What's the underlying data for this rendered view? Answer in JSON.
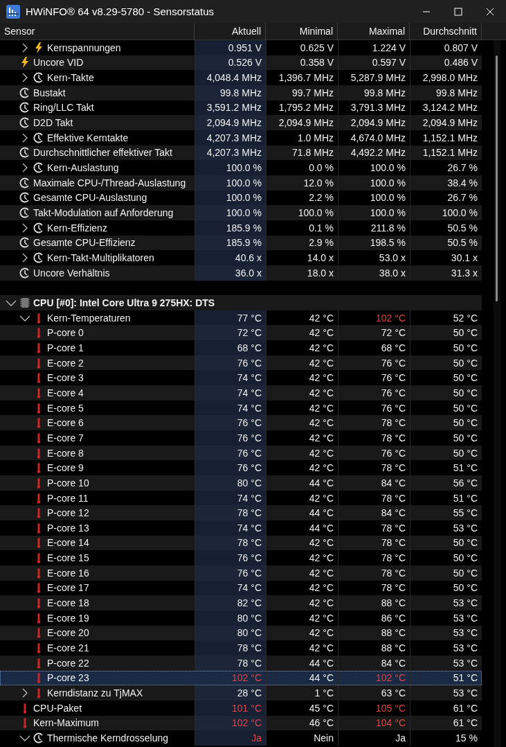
{
  "window": {
    "title": "HWiNFO® 64 v8.29-5780 - Sensorstatus"
  },
  "columns": [
    "Sensor",
    "Aktuell",
    "Minimal",
    "Maximal",
    "Durchschnitt"
  ],
  "groups": [
    {
      "rows": [
        {
          "label": "Kernspannungen",
          "kind": "bolt",
          "expanded": false,
          "selected": false,
          "values": [
            {
              "text": "0.951 V",
              "alert": false
            },
            {
              "text": "0.625 V",
              "alert": false
            },
            {
              "text": "1.224 V",
              "alert": false
            },
            {
              "text": "0.807 V",
              "alert": false
            }
          ]
        },
        {
          "label": "Uncore VID",
          "kind": "bolt",
          "selected": false,
          "values": [
            {
              "text": "0.526 V",
              "alert": false
            },
            {
              "text": "0.358 V",
              "alert": false
            },
            {
              "text": "0.597 V",
              "alert": false
            },
            {
              "text": "0.486 V",
              "alert": false
            }
          ]
        },
        {
          "label": "Kern-Takte",
          "kind": "clock",
          "expanded": false,
          "selected": false,
          "values": [
            {
              "text": "4,048.4 MHz",
              "alert": false
            },
            {
              "text": "1,396.7 MHz",
              "alert": false
            },
            {
              "text": "5,287.9 MHz",
              "alert": false
            },
            {
              "text": "2,998.0 MHz",
              "alert": false
            }
          ]
        },
        {
          "label": "Bustakt",
          "kind": "clock",
          "selected": false,
          "values": [
            {
              "text": "99.8 MHz",
              "alert": false
            },
            {
              "text": "99.7 MHz",
              "alert": false
            },
            {
              "text": "99.8 MHz",
              "alert": false
            },
            {
              "text": "99.8 MHz",
              "alert": false
            }
          ]
        },
        {
          "label": "Ring/LLC Takt",
          "kind": "clock",
          "selected": false,
          "values": [
            {
              "text": "3,591.2 MHz",
              "alert": false
            },
            {
              "text": "1,795.2 MHz",
              "alert": false
            },
            {
              "text": "3,791.3 MHz",
              "alert": false
            },
            {
              "text": "3,124.2 MHz",
              "alert": false
            }
          ]
        },
        {
          "label": "D2D Takt",
          "kind": "clock",
          "selected": false,
          "values": [
            {
              "text": "2,094.9 MHz",
              "alert": false
            },
            {
              "text": "2,094.9 MHz",
              "alert": false
            },
            {
              "text": "2,094.9 MHz",
              "alert": false
            },
            {
              "text": "2,094.9 MHz",
              "alert": false
            }
          ]
        },
        {
          "label": "Effektive Kerntakte",
          "kind": "clock",
          "expanded": false,
          "selected": false,
          "values": [
            {
              "text": "4,207.3 MHz",
              "alert": false
            },
            {
              "text": "1.0 MHz",
              "alert": false
            },
            {
              "text": "4,674.0 MHz",
              "alert": false
            },
            {
              "text": "1,152.1 MHz",
              "alert": false
            }
          ]
        },
        {
          "label": "Durchschnittlicher effektiver Takt",
          "kind": "clock",
          "selected": false,
          "values": [
            {
              "text": "4,207.3 MHz",
              "alert": false
            },
            {
              "text": "71.8 MHz",
              "alert": false
            },
            {
              "text": "4,492.2 MHz",
              "alert": false
            },
            {
              "text": "1,152.1 MHz",
              "alert": false
            }
          ]
        },
        {
          "label": "Kern-Auslastung",
          "kind": "clock",
          "expanded": false,
          "selected": false,
          "values": [
            {
              "text": "100.0 %",
              "alert": false
            },
            {
              "text": "0.0 %",
              "alert": false
            },
            {
              "text": "100.0 %",
              "alert": false
            },
            {
              "text": "26.7 %",
              "alert": false
            }
          ]
        },
        {
          "label": "Maximale CPU-/Thread-Auslastung",
          "kind": "clock",
          "selected": false,
          "values": [
            {
              "text": "100.0 %",
              "alert": false
            },
            {
              "text": "12.0 %",
              "alert": false
            },
            {
              "text": "100.0 %",
              "alert": false
            },
            {
              "text": "38.4 %",
              "alert": false
            }
          ]
        },
        {
          "label": "Gesamte CPU-Auslastung",
          "kind": "clock",
          "selected": false,
          "values": [
            {
              "text": "100.0 %",
              "alert": false
            },
            {
              "text": "2.2 %",
              "alert": false
            },
            {
              "text": "100.0 %",
              "alert": false
            },
            {
              "text": "26.7 %",
              "alert": false
            }
          ]
        },
        {
          "label": "Takt-Modulation auf Anforderung",
          "kind": "clock",
          "selected": false,
          "values": [
            {
              "text": "100.0 %",
              "alert": false
            },
            {
              "text": "100.0 %",
              "alert": false
            },
            {
              "text": "100.0 %",
              "alert": false
            },
            {
              "text": "100.0 %",
              "alert": false
            }
          ]
        },
        {
          "label": "Kern-Effizienz",
          "kind": "clock",
          "expanded": false,
          "selected": false,
          "values": [
            {
              "text": "185.9 %",
              "alert": false
            },
            {
              "text": "0.1 %",
              "alert": false
            },
            {
              "text": "211.8 %",
              "alert": false
            },
            {
              "text": "50.5 %",
              "alert": false
            }
          ]
        },
        {
          "label": "Gesamte CPU-Effizienz",
          "kind": "clock",
          "selected": false,
          "values": [
            {
              "text": "185.9 %",
              "alert": false
            },
            {
              "text": "2.9 %",
              "alert": false
            },
            {
              "text": "198.5 %",
              "alert": false
            },
            {
              "text": "50.5 %",
              "alert": false
            }
          ]
        },
        {
          "label": "Kern-Takt-Multiplikatoren",
          "kind": "clock",
          "expanded": false,
          "selected": false,
          "values": [
            {
              "text": "40.6 x",
              "alert": false
            },
            {
              "text": "14.0 x",
              "alert": false
            },
            {
              "text": "53.0 x",
              "alert": false
            },
            {
              "text": "30.1 x",
              "alert": false
            }
          ]
        },
        {
          "label": "Uncore Verhältnis",
          "kind": "clock",
          "selected": false,
          "values": [
            {
              "text": "36.0 x",
              "alert": false
            },
            {
              "text": "18.0 x",
              "alert": false
            },
            {
              "text": "38.0 x",
              "alert": false
            },
            {
              "text": "31.3 x",
              "alert": false
            }
          ]
        }
      ]
    },
    {
      "title": "CPU [#0]: Intel Core Ultra 9 275HX: DTS",
      "expanded": true,
      "rows": [
        {
          "label": "Kern-Temperaturen",
          "kind": "thermometer",
          "expanded": true,
          "selected": false,
          "values": [
            {
              "text": "77 °C",
              "alert": false
            },
            {
              "text": "42 °C",
              "alert": false
            },
            {
              "text": "102 °C",
              "alert": true
            },
            {
              "text": "52 °C",
              "alert": false
            }
          ],
          "children": [
            {
              "label": "P-core 0",
              "kind": "thermometer",
              "selected": false,
              "values": [
                {
                  "text": "72 °C",
                  "alert": false
                },
                {
                  "text": "42 °C",
                  "alert": false
                },
                {
                  "text": "72 °C",
                  "alert": false
                },
                {
                  "text": "50 °C",
                  "alert": false
                }
              ]
            },
            {
              "label": "P-core 1",
              "kind": "thermometer",
              "selected": false,
              "values": [
                {
                  "text": "68 °C",
                  "alert": false
                },
                {
                  "text": "42 °C",
                  "alert": false
                },
                {
                  "text": "68 °C",
                  "alert": false
                },
                {
                  "text": "50 °C",
                  "alert": false
                }
              ]
            },
            {
              "label": "E-core 2",
              "kind": "thermometer",
              "selected": false,
              "values": [
                {
                  "text": "76 °C",
                  "alert": false
                },
                {
                  "text": "42 °C",
                  "alert": false
                },
                {
                  "text": "76 °C",
                  "alert": false
                },
                {
                  "text": "50 °C",
                  "alert": false
                }
              ]
            },
            {
              "label": "E-core 3",
              "kind": "thermometer",
              "selected": false,
              "values": [
                {
                  "text": "74 °C",
                  "alert": false
                },
                {
                  "text": "42 °C",
                  "alert": false
                },
                {
                  "text": "76 °C",
                  "alert": false
                },
                {
                  "text": "50 °C",
                  "alert": false
                }
              ]
            },
            {
              "label": "E-core 4",
              "kind": "thermometer",
              "selected": false,
              "values": [
                {
                  "text": "74 °C",
                  "alert": false
                },
                {
                  "text": "42 °C",
                  "alert": false
                },
                {
                  "text": "76 °C",
                  "alert": false
                },
                {
                  "text": "50 °C",
                  "alert": false
                }
              ]
            },
            {
              "label": "E-core 5",
              "kind": "thermometer",
              "selected": false,
              "values": [
                {
                  "text": "74 °C",
                  "alert": false
                },
                {
                  "text": "42 °C",
                  "alert": false
                },
                {
                  "text": "76 °C",
                  "alert": false
                },
                {
                  "text": "50 °C",
                  "alert": false
                }
              ]
            },
            {
              "label": "E-core 6",
              "kind": "thermometer",
              "selected": false,
              "values": [
                {
                  "text": "76 °C",
                  "alert": false
                },
                {
                  "text": "42 °C",
                  "alert": false
                },
                {
                  "text": "78 °C",
                  "alert": false
                },
                {
                  "text": "50 °C",
                  "alert": false
                }
              ]
            },
            {
              "label": "E-core 7",
              "kind": "thermometer",
              "selected": false,
              "values": [
                {
                  "text": "76 °C",
                  "alert": false
                },
                {
                  "text": "42 °C",
                  "alert": false
                },
                {
                  "text": "78 °C",
                  "alert": false
                },
                {
                  "text": "50 °C",
                  "alert": false
                }
              ]
            },
            {
              "label": "E-core 8",
              "kind": "thermometer",
              "selected": false,
              "values": [
                {
                  "text": "76 °C",
                  "alert": false
                },
                {
                  "text": "42 °C",
                  "alert": false
                },
                {
                  "text": "76 °C",
                  "alert": false
                },
                {
                  "text": "50 °C",
                  "alert": false
                }
              ]
            },
            {
              "label": "E-core 9",
              "kind": "thermometer",
              "selected": false,
              "values": [
                {
                  "text": "76 °C",
                  "alert": false
                },
                {
                  "text": "42 °C",
                  "alert": false
                },
                {
                  "text": "78 °C",
                  "alert": false
                },
                {
                  "text": "51 °C",
                  "alert": false
                }
              ]
            },
            {
              "label": "P-core 10",
              "kind": "thermometer",
              "selected": false,
              "values": [
                {
                  "text": "80 °C",
                  "alert": false
                },
                {
                  "text": "44 °C",
                  "alert": false
                },
                {
                  "text": "84 °C",
                  "alert": false
                },
                {
                  "text": "56 °C",
                  "alert": false
                }
              ]
            },
            {
              "label": "P-core 11",
              "kind": "thermometer",
              "selected": false,
              "values": [
                {
                  "text": "74 °C",
                  "alert": false
                },
                {
                  "text": "42 °C",
                  "alert": false
                },
                {
                  "text": "78 °C",
                  "alert": false
                },
                {
                  "text": "51 °C",
                  "alert": false
                }
              ]
            },
            {
              "label": "P-core 12",
              "kind": "thermometer",
              "selected": false,
              "values": [
                {
                  "text": "78 °C",
                  "alert": false
                },
                {
                  "text": "44 °C",
                  "alert": false
                },
                {
                  "text": "84 °C",
                  "alert": false
                },
                {
                  "text": "55 °C",
                  "alert": false
                }
              ]
            },
            {
              "label": "P-core 13",
              "kind": "thermometer",
              "selected": false,
              "values": [
                {
                  "text": "74 °C",
                  "alert": false
                },
                {
                  "text": "44 °C",
                  "alert": false
                },
                {
                  "text": "78 °C",
                  "alert": false
                },
                {
                  "text": "53 °C",
                  "alert": false
                }
              ]
            },
            {
              "label": "E-core 14",
              "kind": "thermometer",
              "selected": false,
              "values": [
                {
                  "text": "78 °C",
                  "alert": false
                },
                {
                  "text": "42 °C",
                  "alert": false
                },
                {
                  "text": "78 °C",
                  "alert": false
                },
                {
                  "text": "50 °C",
                  "alert": false
                }
              ]
            },
            {
              "label": "E-core 15",
              "kind": "thermometer",
              "selected": false,
              "values": [
                {
                  "text": "76 °C",
                  "alert": false
                },
                {
                  "text": "42 °C",
                  "alert": false
                },
                {
                  "text": "78 °C",
                  "alert": false
                },
                {
                  "text": "50 °C",
                  "alert": false
                }
              ]
            },
            {
              "label": "E-core 16",
              "kind": "thermometer",
              "selected": false,
              "values": [
                {
                  "text": "76 °C",
                  "alert": false
                },
                {
                  "text": "42 °C",
                  "alert": false
                },
                {
                  "text": "78 °C",
                  "alert": false
                },
                {
                  "text": "50 °C",
                  "alert": false
                }
              ]
            },
            {
              "label": "E-core 17",
              "kind": "thermometer",
              "selected": false,
              "values": [
                {
                  "text": "74 °C",
                  "alert": false
                },
                {
                  "text": "42 °C",
                  "alert": false
                },
                {
                  "text": "78 °C",
                  "alert": false
                },
                {
                  "text": "50 °C",
                  "alert": false
                }
              ]
            },
            {
              "label": "E-core 18",
              "kind": "thermometer",
              "selected": false,
              "values": [
                {
                  "text": "82 °C",
                  "alert": false
                },
                {
                  "text": "42 °C",
                  "alert": false
                },
                {
                  "text": "88 °C",
                  "alert": false
                },
                {
                  "text": "53 °C",
                  "alert": false
                }
              ]
            },
            {
              "label": "E-core 19",
              "kind": "thermometer",
              "selected": false,
              "values": [
                {
                  "text": "80 °C",
                  "alert": false
                },
                {
                  "text": "42 °C",
                  "alert": false
                },
                {
                  "text": "86 °C",
                  "alert": false
                },
                {
                  "text": "53 °C",
                  "alert": false
                }
              ]
            },
            {
              "label": "E-core 20",
              "kind": "thermometer",
              "selected": false,
              "values": [
                {
                  "text": "80 °C",
                  "alert": false
                },
                {
                  "text": "42 °C",
                  "alert": false
                },
                {
                  "text": "88 °C",
                  "alert": false
                },
                {
                  "text": "53 °C",
                  "alert": false
                }
              ]
            },
            {
              "label": "E-core 21",
              "kind": "thermometer",
              "selected": false,
              "values": [
                {
                  "text": "78 °C",
                  "alert": false
                },
                {
                  "text": "42 °C",
                  "alert": false
                },
                {
                  "text": "88 °C",
                  "alert": false
                },
                {
                  "text": "53 °C",
                  "alert": false
                }
              ]
            },
            {
              "label": "P-core 22",
              "kind": "thermometer",
              "selected": false,
              "values": [
                {
                  "text": "78 °C",
                  "alert": false
                },
                {
                  "text": "44 °C",
                  "alert": false
                },
                {
                  "text": "84 °C",
                  "alert": false
                },
                {
                  "text": "53 °C",
                  "alert": false
                }
              ]
            },
            {
              "label": "P-core 23",
              "kind": "thermometer",
              "selected": true,
              "values": [
                {
                  "text": "102 °C",
                  "alert": true
                },
                {
                  "text": "44 °C",
                  "alert": false
                },
                {
                  "text": "102 °C",
                  "alert": true
                },
                {
                  "text": "51 °C",
                  "alert": false
                }
              ]
            }
          ]
        },
        {
          "label": "Kerndistanz zu TjMAX",
          "kind": "thermometer",
          "expanded": false,
          "selected": false,
          "values": [
            {
              "text": "28 °C",
              "alert": false
            },
            {
              "text": "1 °C",
              "alert": false
            },
            {
              "text": "63 °C",
              "alert": false
            },
            {
              "text": "53 °C",
              "alert": false
            }
          ]
        },
        {
          "label": "CPU-Paket",
          "kind": "thermometer",
          "selected": false,
          "values": [
            {
              "text": "101 °C",
              "alert": true
            },
            {
              "text": "45 °C",
              "alert": false
            },
            {
              "text": "105 °C",
              "alert": true
            },
            {
              "text": "61 °C",
              "alert": false
            }
          ]
        },
        {
          "label": "Kern-Maximum",
          "kind": "thermometer",
          "selected": false,
          "values": [
            {
              "text": "102 °C",
              "alert": true
            },
            {
              "text": "46 °C",
              "alert": false
            },
            {
              "text": "104 °C",
              "alert": true
            },
            {
              "text": "61 °C",
              "alert": false
            }
          ]
        },
        {
          "label": "Thermische Kerndrosselung",
          "kind": "clock",
          "expanded": true,
          "selected": false,
          "values": [
            {
              "text": "Ja",
              "alert": true
            },
            {
              "text": "Nein",
              "alert": false
            },
            {
              "text": "Ja",
              "alert": false
            },
            {
              "text": "15 %",
              "alert": false
            }
          ]
        }
      ]
    }
  ]
}
